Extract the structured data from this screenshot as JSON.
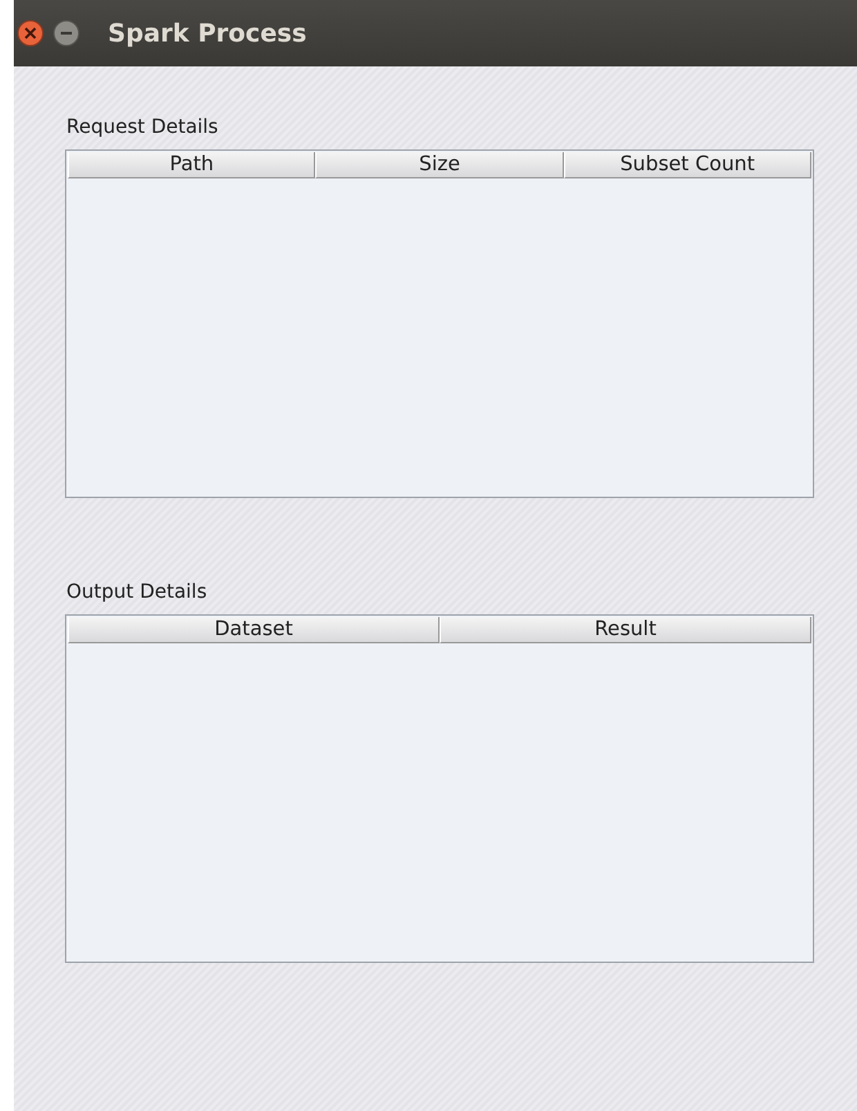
{
  "window": {
    "title": "Spark Process"
  },
  "sections": [
    {
      "label": "Request Details",
      "columns": [
        "Path",
        "Size",
        "Subset Count"
      ]
    },
    {
      "label": "Output Details",
      "columns": [
        "Dataset",
        "Result"
      ]
    }
  ]
}
